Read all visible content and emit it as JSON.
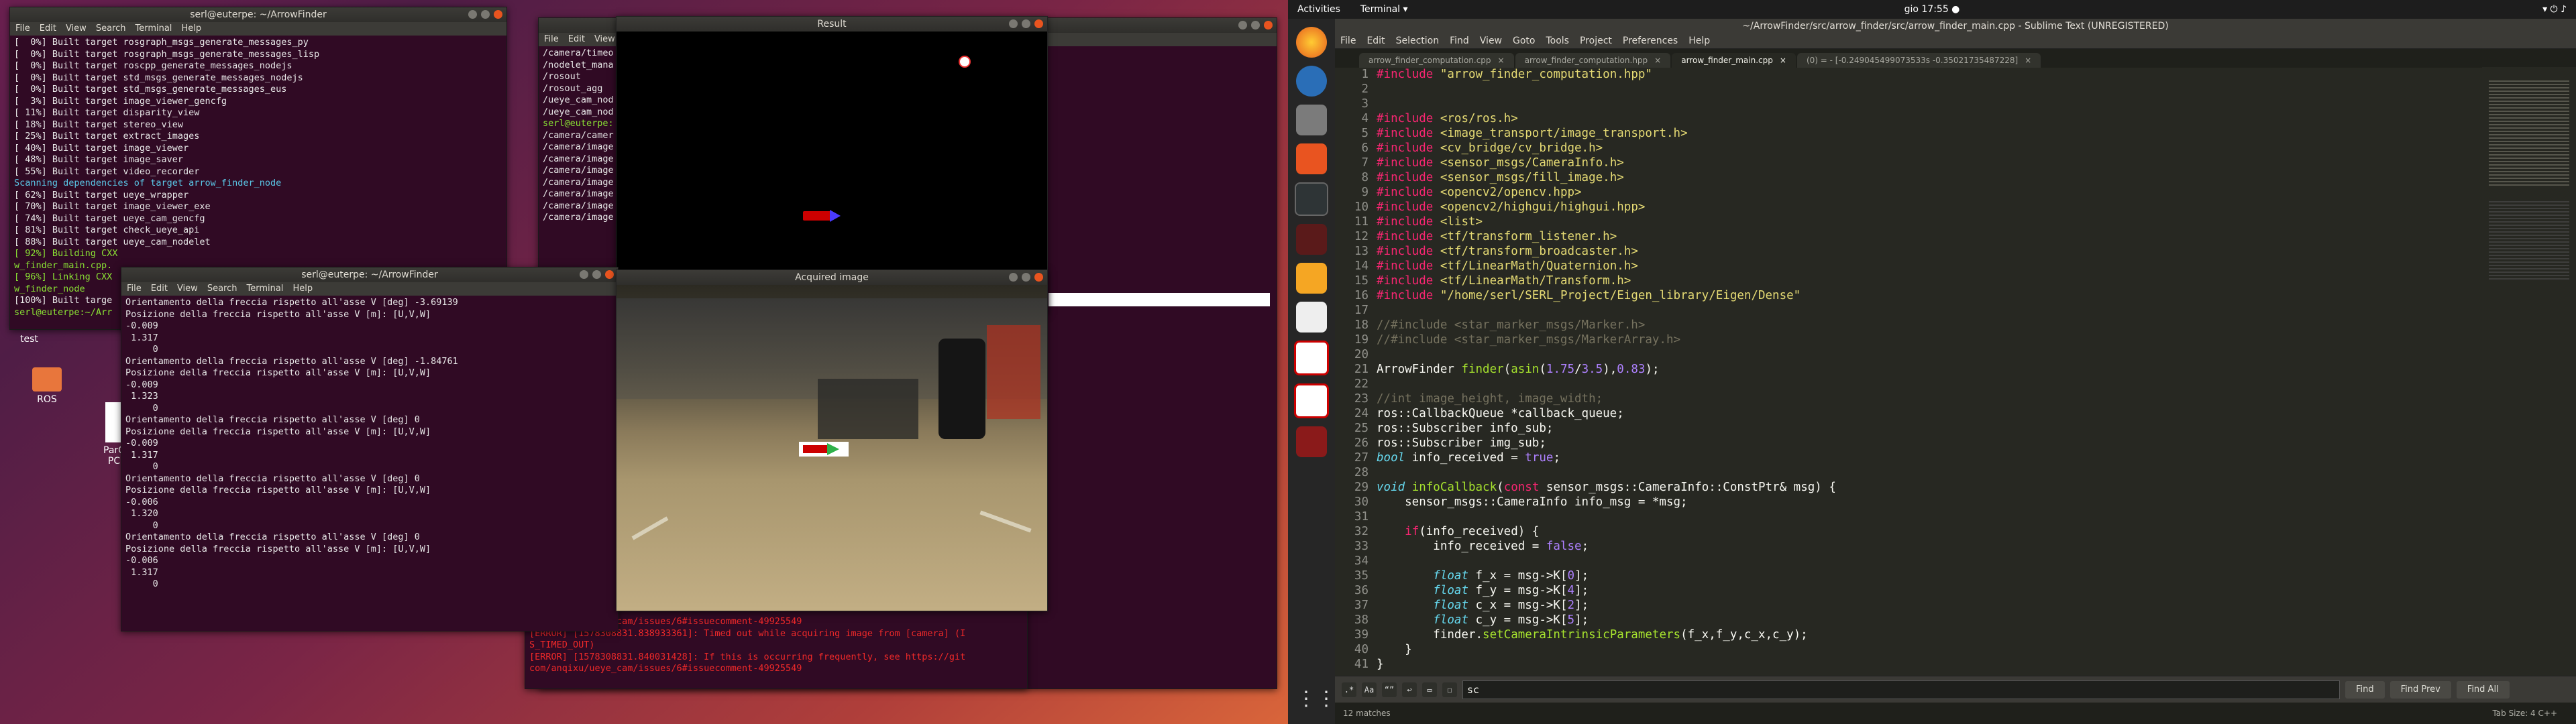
{
  "left": {
    "desktop": {
      "test_label": "test",
      "ros_label": "ROS",
      "parc_label": "ParC",
      "pc_label": "PC"
    },
    "build_term": {
      "title": "serl@euterpe: ~/ArrowFinder",
      "menu": [
        "File",
        "Edit",
        "View",
        "Search",
        "Terminal",
        "Help"
      ],
      "lines": [
        "[  0%] Built target rosgraph_msgs_generate_messages_py",
        "[  0%] Built target rosgraph_msgs_generate_messages_lisp",
        "[  0%] Built target roscpp_generate_messages_nodejs",
        "[  0%] Built target std_msgs_generate_messages_nodejs",
        "[  0%] Built target std_msgs_generate_messages_eus",
        "[  3%] Built target image_viewer_gencfg",
        "[ 11%] Built target disparity_view",
        "[ 18%] Built target stereo_view",
        "[ 25%] Built target extract_images",
        "[ 40%] Built target image_viewer",
        "[ 48%] Built target image_saver",
        "[ 55%] Built target video_recorder",
        "Scanning dependencies of target arrow_finder_node",
        "[ 62%] Built target ueye_wrapper",
        "[ 70%] Built target image_viewer_exe",
        "[ 74%] Built target ueye_cam_gencfg",
        "[ 81%] Built target check_ueye_api",
        "[ 88%] Built target ueye_cam_nodelet",
        "[ 92%] Building CXX",
        "w_finder_main.cpp.",
        "[ 96%] Linking CXX",
        "w_finder_node",
        "[100%] Built targe",
        "serl@euterpe:~/Arr"
      ]
    },
    "rostopic_term": {
      "menu": [
        "File",
        "Edit",
        "View"
      ],
      "lines": [
        "/camera/timeo",
        "/nodelet_mana",
        "/rosout",
        "/rosout_agg",
        "/ueye_cam_nod",
        "/ueye_cam_nod",
        "serl@euterpe:",
        "/camera/camer",
        "/camera/image",
        "/camera/image",
        "/camera/image",
        "/camera/image",
        "/camera/image",
        "/camera/image",
        "/camera/image"
      ],
      "error_lines": [
        "com/anqixu/ueye_cam/issues/6#issuecomment-49925549",
        "[ERROR] [1578308831.838933361]: Timed out while acquiring image from [camera] (I",
        "S_TIMED_OUT)",
        "[ERROR] [1578308831.840031428]: If this is occurring frequently, see https://git",
        "com/anqixu/ueye_cam/issues/6#issuecomment-49925549"
      ]
    },
    "result_win": {
      "title": "Result"
    },
    "acquired_win": {
      "title": "Acquired image"
    },
    "arrow_term": {
      "title": "serl@euterpe: ~/ArrowFinder",
      "menu": [
        "File",
        "Edit",
        "View",
        "Search",
        "Terminal",
        "Help"
      ],
      "lines": [
        "Orientamento della freccia rispetto all'asse V [deg] -3.69139",
        "Posizione della freccia rispetto all'asse V [m]: [U,V,W]",
        "-0.009",
        " 1.317",
        "     0",
        "Orientamento della freccia rispetto all'asse V [deg] -1.84761",
        "Posizione della freccia rispetto all'asse V [m]: [U,V,W]",
        "-0.009",
        " 1.323",
        "     0",
        "Orientamento della freccia rispetto all'asse V [deg] 0",
        "Posizione della freccia rispetto all'asse V [m]: [U,V,W]",
        "-0.009",
        " 1.317",
        "     0",
        "Orientamento della freccia rispetto all'asse V [deg] 0",
        "Posizione della freccia rispetto all'asse V [m]: [U,V,W]",
        "-0.006",
        " 1.320",
        "     0",
        "Orientamento della freccia rispetto all'asse V [deg] 0",
        "Posizione della freccia rispetto all'asse V [m]: [U,V,W]",
        "-0.006",
        " 1.317",
        "     0"
      ]
    }
  },
  "right": {
    "topbar": {
      "activities": "Activities",
      "app": "Terminal ▾",
      "clock": "gio 17:55 ●"
    },
    "sublime": {
      "title": "~/ArrowFinder/src/arrow_finder/src/arrow_finder_main.cpp - Sublime Text (UNREGISTERED)",
      "menu": [
        "File",
        "Edit",
        "Selection",
        "Find",
        "View",
        "Goto",
        "Tools",
        "Project",
        "Preferences",
        "Help"
      ],
      "tabs": [
        {
          "label": "arrow_finder_computation.cpp",
          "active": false
        },
        {
          "label": "arrow_finder_computation.hpp",
          "active": false
        },
        {
          "label": "arrow_finder_main.cpp",
          "active": true
        },
        {
          "label": "(0) = - [-0.249045499073533s -0.35021735487228]",
          "active": false
        }
      ],
      "find_placeholder": "sc",
      "find_btn": "Find",
      "find_prev_btn": "Find Prev",
      "find_all_btn": "Find All",
      "status": "12 matches",
      "status_right": "Tab Size: 4     C++"
    }
  }
}
